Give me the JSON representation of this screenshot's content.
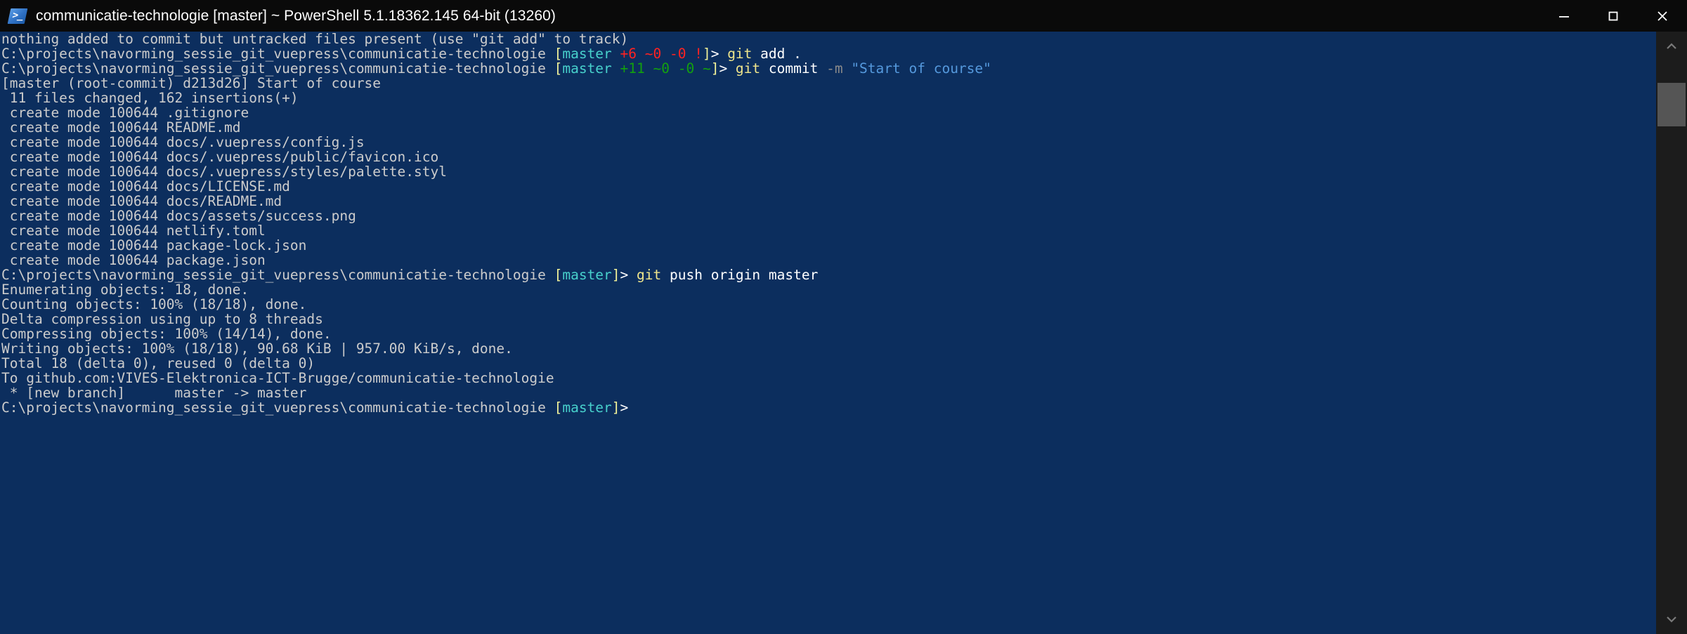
{
  "window": {
    "title": "communicatie-technologie [master] ~ PowerShell 5.1.18362.145 64-bit (13260)",
    "icon": "powershell-icon",
    "icon_glyph": ">_",
    "background_color": "#0c2e5e",
    "titlebar_color": "#0a0a0a",
    "controls": {
      "minimize_label": "Minimize",
      "maximize_label": "Maximize",
      "close_label": "Close"
    }
  },
  "colors": {
    "console_background": "#0c2e5e",
    "default_text": "#cccccc",
    "bracket_yellow": "#f3f399",
    "command_yellow": "#f0e68c",
    "branch_cyan": "#48d1cc",
    "status_red": "#ff2222",
    "status_green": "#13a10e",
    "string_blue": "#5599dd",
    "parameter_gray": "#8a8a8a"
  },
  "scrollbar": {
    "up_arrow": "chevron-up-icon",
    "down_arrow": "chevron-down-icon",
    "thumb_position_percent": 4
  },
  "console": {
    "lines": [
      {
        "id": "l01",
        "segments": [
          {
            "text": "nothing added to commit but untracked files present (use \"git add\" to track)",
            "color": "w"
          }
        ]
      },
      {
        "id": "l02",
        "segments": [
          {
            "text": "C:\\projects\\navorming_sessie_git_vuepress\\communicatie-technologie ",
            "color": "w"
          },
          {
            "text": "[",
            "color": "ylw"
          },
          {
            "text": "master",
            "color": "cya"
          },
          {
            "text": " ",
            "color": "w"
          },
          {
            "text": "+6 ~0 -0 !",
            "color": "red"
          },
          {
            "text": "]",
            "color": "ylw"
          },
          {
            "text": "> ",
            "color": "br"
          },
          {
            "text": "git",
            "color": "cmd"
          },
          {
            "text": " add .",
            "color": "br"
          }
        ]
      },
      {
        "id": "l03",
        "segments": [
          {
            "text": "C:\\projects\\navorming_sessie_git_vuepress\\communicatie-technologie ",
            "color": "w"
          },
          {
            "text": "[",
            "color": "ylw"
          },
          {
            "text": "master",
            "color": "cya"
          },
          {
            "text": " ",
            "color": "w"
          },
          {
            "text": "+11 ~0 -0 ~",
            "color": "grn"
          },
          {
            "text": "]",
            "color": "ylw"
          },
          {
            "text": "> ",
            "color": "br"
          },
          {
            "text": "git",
            "color": "cmd"
          },
          {
            "text": " commit ",
            "color": "br"
          },
          {
            "text": "-m",
            "color": "gry"
          },
          {
            "text": " ",
            "color": "br"
          },
          {
            "text": "\"Start of course\"",
            "color": "blu"
          }
        ]
      },
      {
        "id": "l04",
        "segments": [
          {
            "text": "[master (root-commit) d213d26] Start of course",
            "color": "w"
          }
        ]
      },
      {
        "id": "l05",
        "segments": [
          {
            "text": " 11 files changed, 162 insertions(+)",
            "color": "w"
          }
        ]
      },
      {
        "id": "l06",
        "segments": [
          {
            "text": " create mode 100644 .gitignore",
            "color": "w"
          }
        ]
      },
      {
        "id": "l07",
        "segments": [
          {
            "text": " create mode 100644 README.md",
            "color": "w"
          }
        ]
      },
      {
        "id": "l08",
        "segments": [
          {
            "text": " create mode 100644 docs/.vuepress/config.js",
            "color": "w"
          }
        ]
      },
      {
        "id": "l09",
        "segments": [
          {
            "text": " create mode 100644 docs/.vuepress/public/favicon.ico",
            "color": "w"
          }
        ]
      },
      {
        "id": "l10",
        "segments": [
          {
            "text": " create mode 100644 docs/.vuepress/styles/palette.styl",
            "color": "w"
          }
        ]
      },
      {
        "id": "l11",
        "segments": [
          {
            "text": " create mode 100644 docs/LICENSE.md",
            "color": "w"
          }
        ]
      },
      {
        "id": "l12",
        "segments": [
          {
            "text": " create mode 100644 docs/README.md",
            "color": "w"
          }
        ]
      },
      {
        "id": "l13",
        "segments": [
          {
            "text": " create mode 100644 docs/assets/success.png",
            "color": "w"
          }
        ]
      },
      {
        "id": "l14",
        "segments": [
          {
            "text": " create mode 100644 netlify.toml",
            "color": "w"
          }
        ]
      },
      {
        "id": "l15",
        "segments": [
          {
            "text": " create mode 100644 package-lock.json",
            "color": "w"
          }
        ]
      },
      {
        "id": "l16",
        "segments": [
          {
            "text": " create mode 100644 package.json",
            "color": "w"
          }
        ]
      },
      {
        "id": "l17",
        "segments": [
          {
            "text": "C:\\projects\\navorming_sessie_git_vuepress\\communicatie-technologie ",
            "color": "w"
          },
          {
            "text": "[",
            "color": "ylw"
          },
          {
            "text": "master",
            "color": "cya"
          },
          {
            "text": "]",
            "color": "ylw"
          },
          {
            "text": "> ",
            "color": "br"
          },
          {
            "text": "git",
            "color": "cmd"
          },
          {
            "text": " push origin master",
            "color": "br"
          }
        ]
      },
      {
        "id": "l18",
        "segments": [
          {
            "text": "Enumerating objects: 18, done.",
            "color": "w"
          }
        ]
      },
      {
        "id": "l19",
        "segments": [
          {
            "text": "Counting objects: 100% (18/18), done.",
            "color": "w"
          }
        ]
      },
      {
        "id": "l20",
        "segments": [
          {
            "text": "Delta compression using up to 8 threads",
            "color": "w"
          }
        ]
      },
      {
        "id": "l21",
        "segments": [
          {
            "text": "Compressing objects: 100% (14/14), done.",
            "color": "w"
          }
        ]
      },
      {
        "id": "l22",
        "segments": [
          {
            "text": "Writing objects: 100% (18/18), 90.68 KiB | 957.00 KiB/s, done.",
            "color": "w"
          }
        ]
      },
      {
        "id": "l23",
        "segments": [
          {
            "text": "Total 18 (delta 0), reused 0 (delta 0)",
            "color": "w"
          }
        ]
      },
      {
        "id": "l24",
        "segments": [
          {
            "text": "To github.com:VIVES-Elektronica-ICT-Brugge/communicatie-technologie",
            "color": "w"
          }
        ]
      },
      {
        "id": "l25",
        "segments": [
          {
            "text": " * [new branch]      master -> master",
            "color": "w"
          }
        ]
      },
      {
        "id": "l26",
        "segments": [
          {
            "text": "C:\\projects\\navorming_sessie_git_vuepress\\communicatie-technologie ",
            "color": "w"
          },
          {
            "text": "[",
            "color": "ylw"
          },
          {
            "text": "master",
            "color": "cya"
          },
          {
            "text": "]",
            "color": "ylw"
          },
          {
            "text": ">",
            "color": "br"
          }
        ]
      }
    ]
  }
}
